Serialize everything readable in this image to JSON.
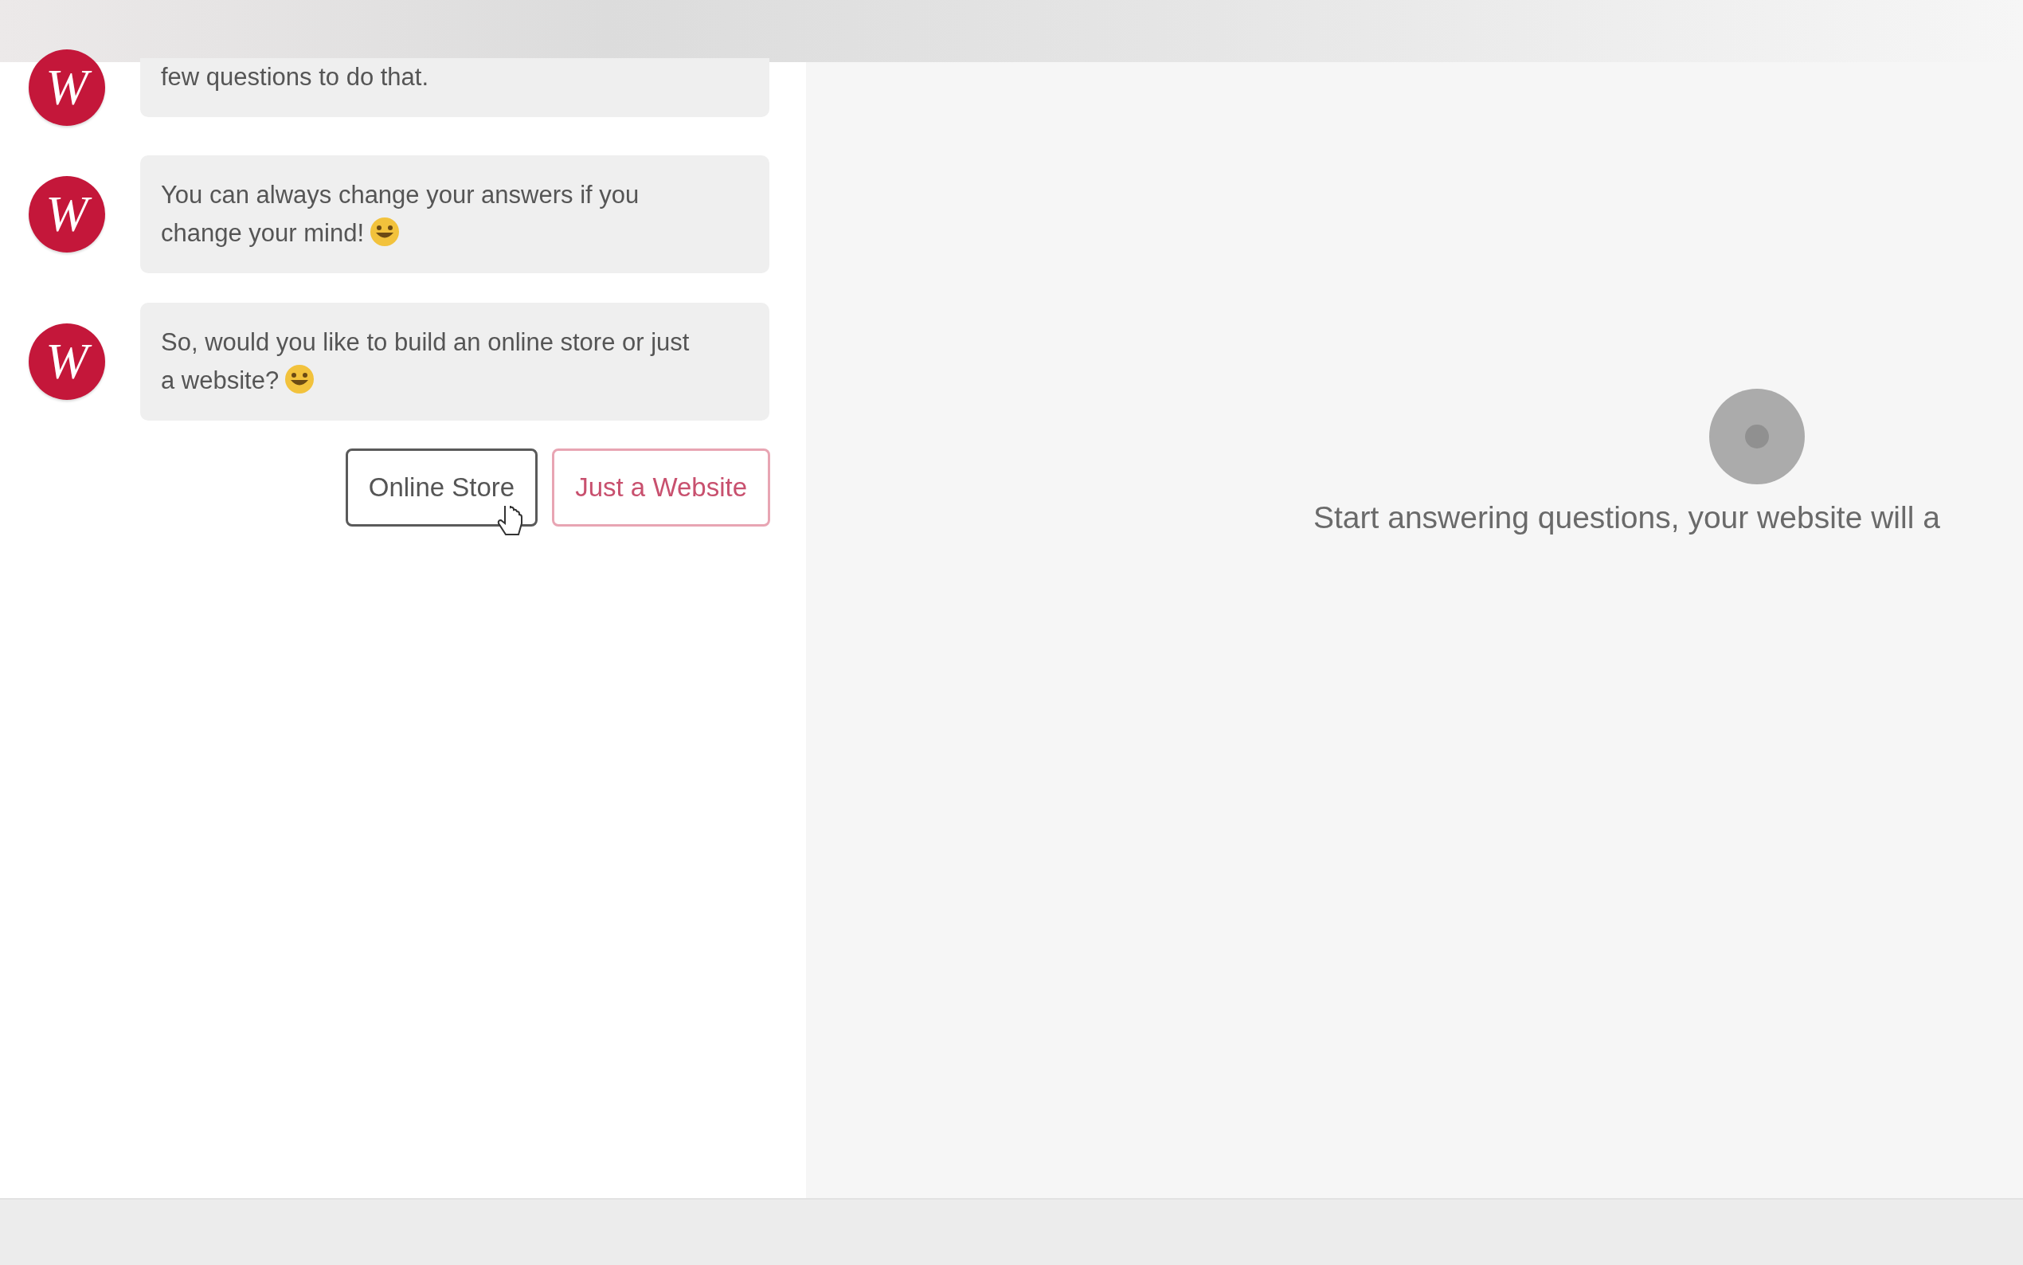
{
  "chat": {
    "messages": [
      {
        "avatar": "W",
        "text": "few questions to do that.",
        "emoji": false,
        "clipped_top": true
      },
      {
        "avatar": "W",
        "text": "You can always change your answers if you change your mind!",
        "emoji": true,
        "clipped_top": false
      },
      {
        "avatar": "W",
        "text": "So, would you like to build an online store or just a website?",
        "emoji": true,
        "clipped_top": false
      }
    ],
    "choices": [
      {
        "label": "Online Store",
        "hovered": true
      },
      {
        "label": "Just a Website",
        "hovered": false
      }
    ]
  },
  "preview": {
    "loading": true,
    "message": "Start answering questions, your website will a"
  }
}
